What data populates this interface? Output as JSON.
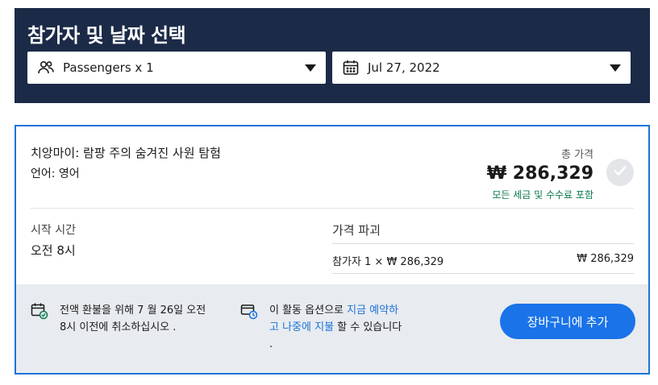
{
  "header": {
    "title": "참가자 및 날짜 선택",
    "passengers_label": "Passengers x 1",
    "date_label": "Jul 27, 2022"
  },
  "activity": {
    "title": "치앙마이: 람팡 주의 숨겨진 사원 탐험",
    "language": "언어: 영어",
    "total_label": "총 가격",
    "currency": "₩",
    "total_amount": "286,329",
    "tax_note": "모든 세금 및 수수료 포함",
    "start_label": "시작 시간",
    "start_value": "오전 8시"
  },
  "breakdown": {
    "title": "가격 파괴",
    "item": "참가자 1 × ₩ 286,329",
    "amount": "₩ 286,329"
  },
  "footer": {
    "cancel_policy_1": "전액 환불을 위해 7 월 26일 오전",
    "cancel_policy_2": "8시 이전에 취소하십시오 .",
    "pay_later_prefix": "이 활동 옵션으로 ",
    "pay_later_link1": "지금 예약하",
    "pay_later_link2": "고 나중에 지불",
    "pay_later_suffix": " 할 수 있습니다",
    "pay_later_period": ".",
    "cart_button": "장바구니에 추가"
  },
  "colors": {
    "header_bg": "#1b2a47",
    "accent": "#1a73d8",
    "tax_green": "#0b7a4b",
    "footer_bg": "#e8ebef"
  },
  "icons": [
    "people-icon",
    "calendar-icon",
    "chevron-down-icon",
    "check-icon",
    "calendar-check-icon",
    "card-clock-icon"
  ]
}
